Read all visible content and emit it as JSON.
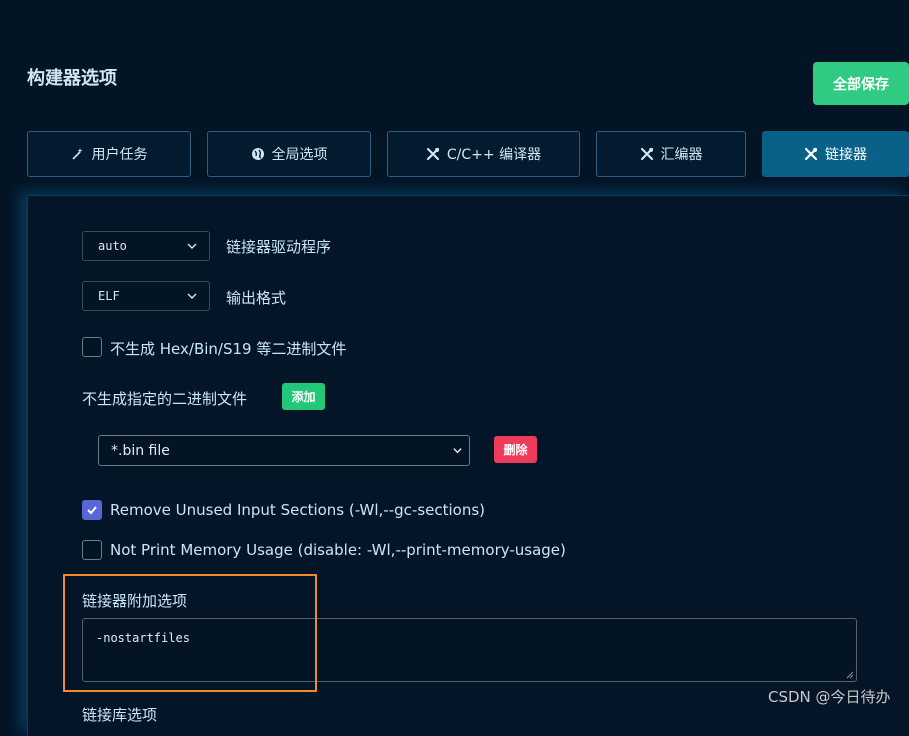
{
  "header": {
    "title": "构建器选项",
    "save_all_label": "全部保存"
  },
  "tabs": [
    {
      "label": "用户任务",
      "icon": "wand-icon"
    },
    {
      "label": "全局选项",
      "icon": "globe-icon"
    },
    {
      "label": "C/C++ 编译器",
      "icon": "tools-icon"
    },
    {
      "label": "汇编器",
      "icon": "tools-icon"
    },
    {
      "label": "链接器",
      "icon": "tools-icon",
      "active": true
    }
  ],
  "linker": {
    "driver_select": {
      "value": "auto",
      "label": "链接器驱动程序"
    },
    "output_format": {
      "value": "ELF",
      "label": "输出格式"
    },
    "no_binary": {
      "checked": false,
      "label": "不生成 Hex/Bin/S19 等二进制文件"
    },
    "excluded_binaries": {
      "label": "不生成指定的二进制文件",
      "add_label": "添加",
      "select_value": "*.bin file",
      "delete_label": "删除"
    },
    "gc_sections": {
      "checked": true,
      "label": "Remove Unused Input Sections (-Wl,--gc-sections)"
    },
    "no_print_memory": {
      "checked": false,
      "label": "Not Print Memory Usage (disable: -Wl,--print-memory-usage)"
    },
    "extra_options": {
      "label": "链接器附加选项",
      "value": "-nostartfiles"
    },
    "next_section_label": "链接库选项"
  },
  "watermark": "CSDN @今日待办"
}
